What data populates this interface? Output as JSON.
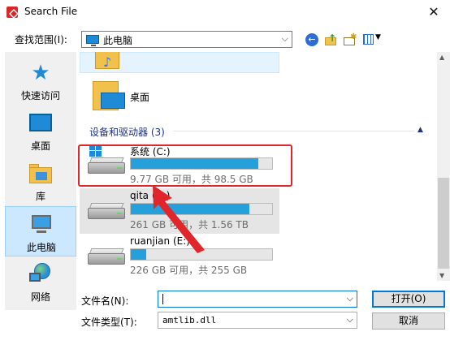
{
  "window": {
    "title": "Search File",
    "close_symbol": "✕"
  },
  "toolbar": {
    "look_in_label": "查找范围(I):",
    "look_in_value": "此电脑",
    "icons": [
      "back-icon",
      "up-folder-icon",
      "new-folder-icon",
      "view-menu-icon"
    ]
  },
  "places": [
    {
      "label": "快速访问",
      "icon": "quick-access-icon"
    },
    {
      "label": "桌面",
      "icon": "desktop-icon"
    },
    {
      "label": "库",
      "icon": "library-icon"
    },
    {
      "label": "此电脑",
      "icon": "this-pc-icon",
      "selected": true
    },
    {
      "label": "网络",
      "icon": "network-icon"
    }
  ],
  "filelist": {
    "partial_item_label": "音乐",
    "desktop_label": "桌面",
    "group_header": "设备和驱动器 (3)",
    "drives": [
      {
        "name": "系统 (C:)",
        "info": "9.77 GB 可用，共 98.5 GB",
        "used_fraction": 0.9
      },
      {
        "name": "qita (D:)",
        "info": "261 GB 可用，共 1.56 TB",
        "used_fraction": 0.84
      },
      {
        "name": "ruanjian (E:)",
        "info": "226 GB 可用，共 255 GB",
        "used_fraction": 0.11
      }
    ]
  },
  "form": {
    "filename_label": "文件名(N):",
    "filename_value": "",
    "filetype_label": "文件类型(T):",
    "filetype_value": "amtlib.dll",
    "open_label": "打开(O)",
    "cancel_label": "取消"
  },
  "colors": {
    "accent": "#0078d7",
    "annotation": "#e0262a",
    "drive_fill": "#26a0da"
  }
}
